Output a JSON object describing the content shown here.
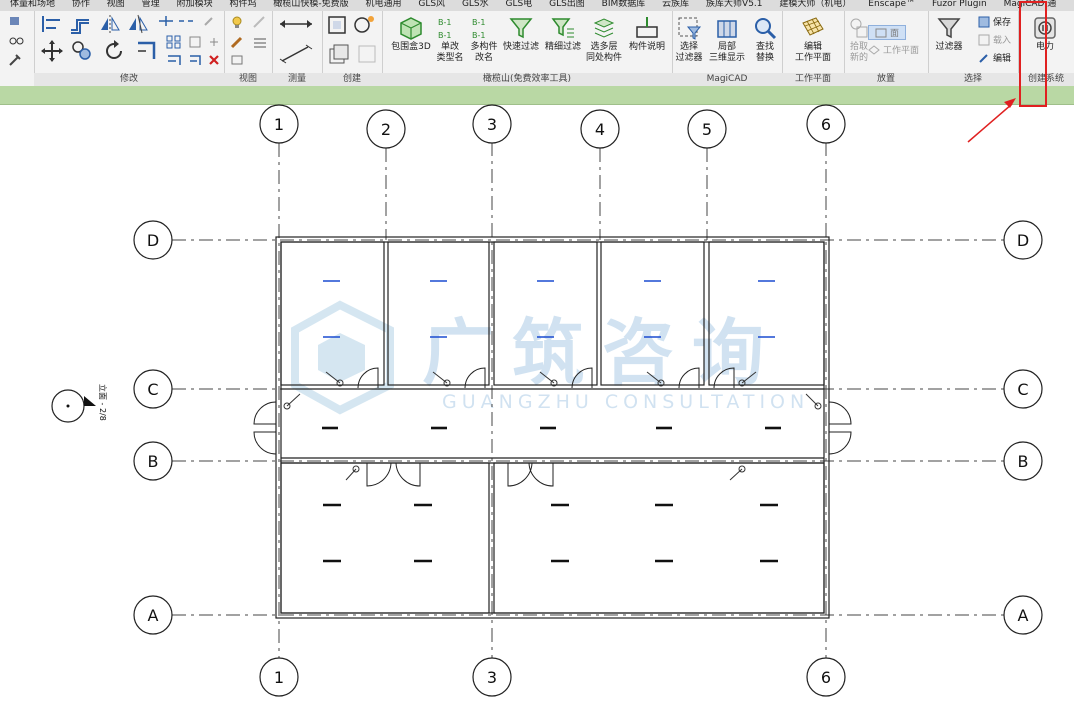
{
  "menubar": {
    "items": [
      "体量和场地",
      "协作",
      "视图",
      "管理",
      "附加模块",
      "构件坞",
      "橄榄山快模-免费版",
      "机电通用",
      "GLS风",
      "GLS水",
      "GLS电",
      "GLS出图",
      "BIM数据库",
      "云族库",
      "族库大师V5.1",
      "建模大师（机电）",
      "Enscape™",
      "Fuzor Plugin",
      "MagiCAD 通"
    ]
  },
  "ribbon": {
    "panels": {
      "modify": "修改",
      "view": "视图",
      "measure": "测量",
      "create": "创建",
      "olive": "橄榄山(免费效率工具)",
      "magicad": "MagiCAD",
      "workplane": "工作平面",
      "place": "放置",
      "select": "选择",
      "create_system": "创建系统"
    },
    "tools": {
      "box3d": "包围盒3D",
      "rename_single_1": "单改",
      "rename_single_2": "类型名",
      "rename_multi_1": "多构件",
      "rename_multi_2": "改名",
      "quick_filter": "快速过滤",
      "fine_filter": "精细过滤",
      "multi_level_1": "选多层",
      "multi_level_2": "同处构件",
      "component_desc": "构件说明",
      "select_filter_1": "选择",
      "select_filter_2": "过滤器",
      "local_3d_1": "局部",
      "local_3d_2": "三维显示",
      "find_replace_1": "查找",
      "find_replace_2": "替换",
      "edit_workplane_1": "编辑",
      "edit_workplane_2": "工作平面",
      "pick_new_1": "拾取",
      "pick_new_2": "新的",
      "face": "面",
      "work_plane": "工作平面",
      "filter": "过滤器",
      "save": "保存",
      "load": "载入",
      "edit": "编辑",
      "power": "电力"
    },
    "badges": {
      "b1": "B-1"
    }
  },
  "drawing": {
    "grid_numbers": [
      "1",
      "2",
      "3",
      "4",
      "5",
      "6"
    ],
    "grid_letters": [
      "A",
      "B",
      "C",
      "D"
    ],
    "watermark_cn": "广筑咨询",
    "watermark_en": "GUANGZHU CONSULTATION",
    "section_label": "立面 - 2/8",
    "highlight_color": "#e02020",
    "fixture_color": "#1a4bd0"
  }
}
